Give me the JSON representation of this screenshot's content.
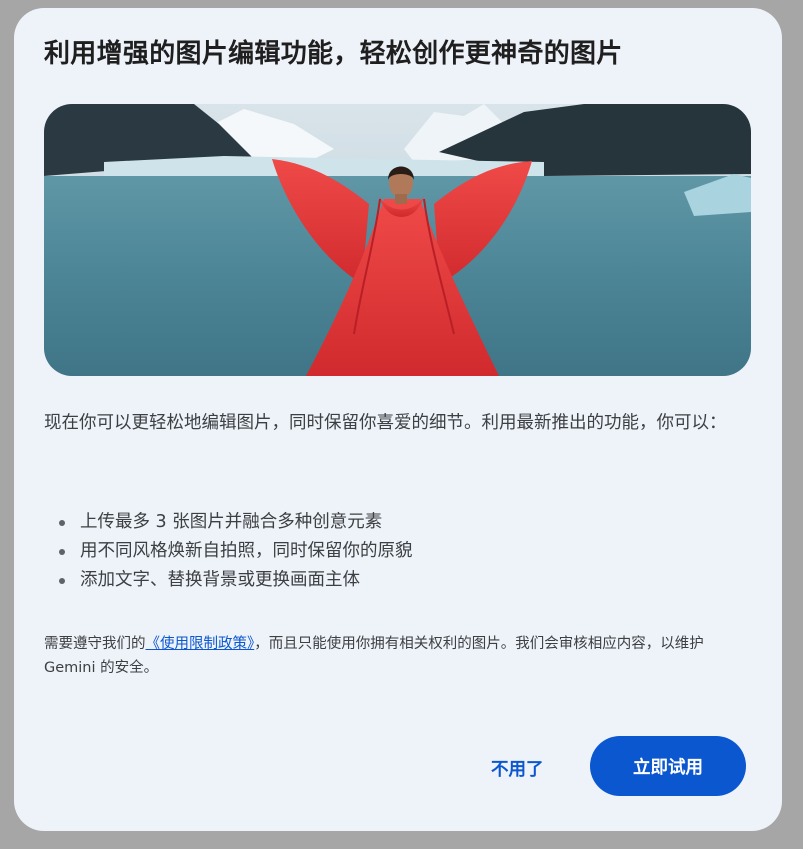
{
  "dialog": {
    "title": "利用增强的图片编辑功能，轻松创作更神奇的图片",
    "description": "现在你可以更轻松地编辑图片，同时保留你喜爱的细节。利用最新推出的功能，你可以：",
    "features": [
      "上传最多 3 张图片并融合多种创意元素",
      "用不同风格焕新自拍照，同时保留你的原貌",
      "添加文字、替换背景或更换画面主体"
    ],
    "notice_prefix": "需要遵守我们的",
    "policy_link": "《使用限制政策》",
    "notice_suffix": "，而且只能使用你拥有相关权利的图片。我们会审核相应内容，以维护 Gemini 的安全。",
    "dismiss_label": "不用了",
    "try_label": "立即试用"
  },
  "colors": {
    "overlay": "#a6a6a6",
    "dialog_background": "#eef2f9",
    "accent": "#0b57d0",
    "text_primary": "#1f1f1f",
    "text_body": "#3c4043"
  }
}
